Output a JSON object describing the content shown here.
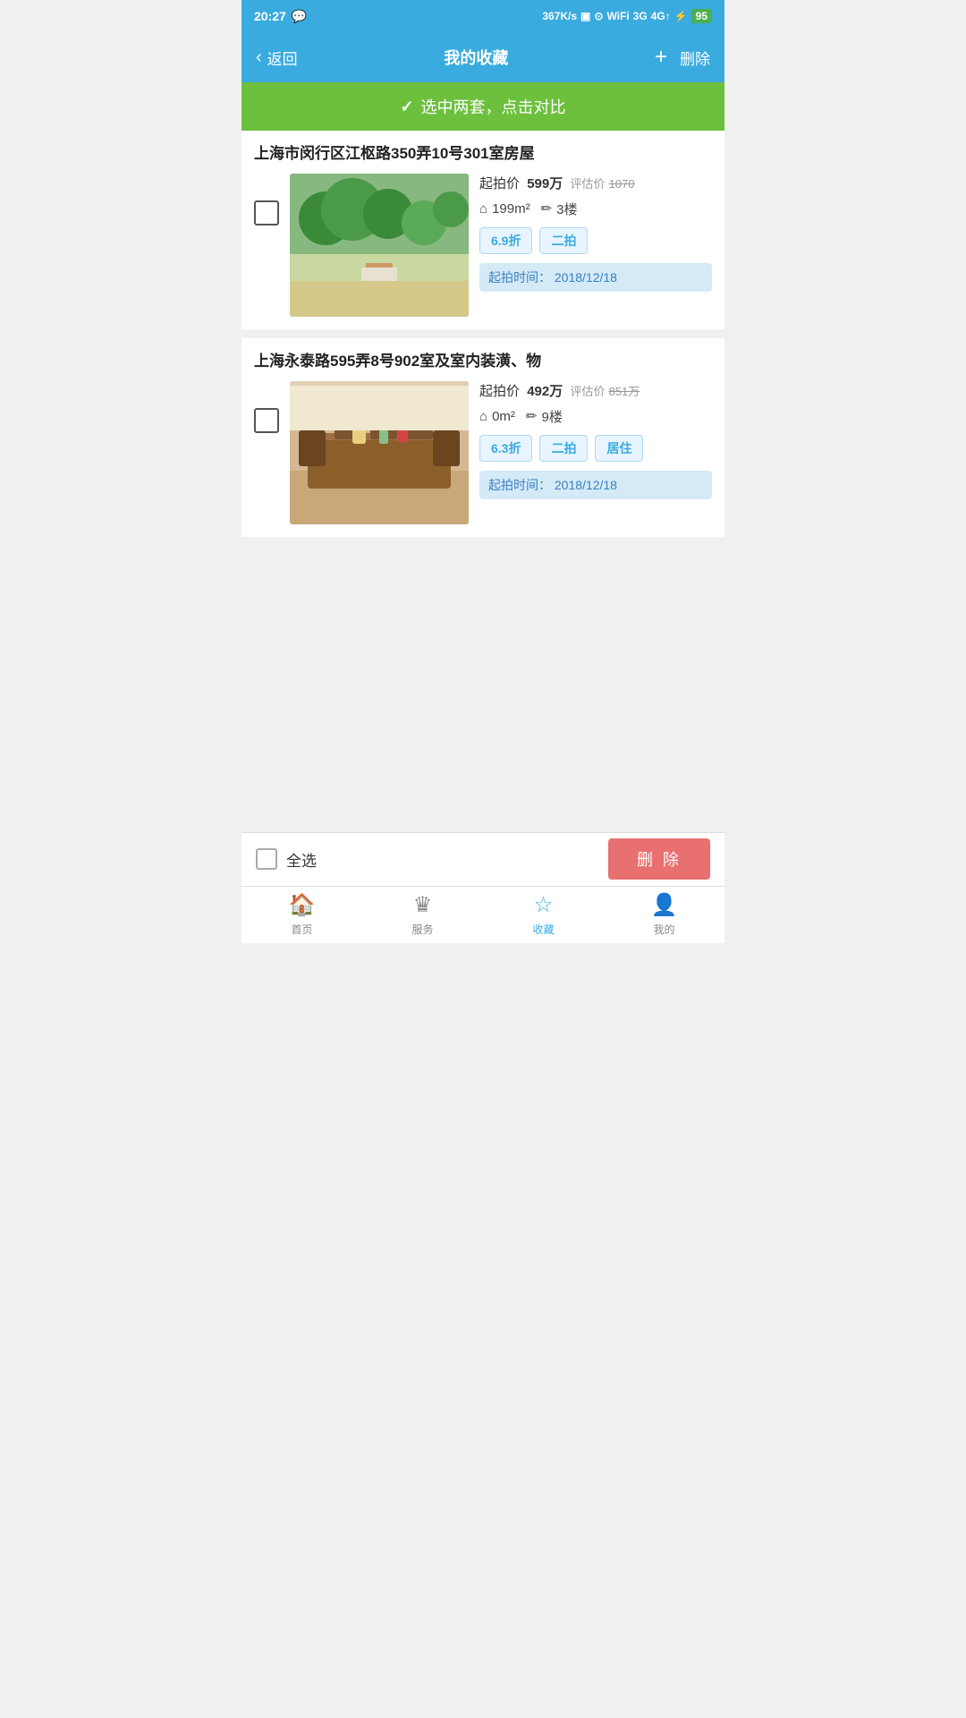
{
  "statusBar": {
    "time": "20:27",
    "network": "367K/s",
    "battery": "95"
  },
  "header": {
    "backLabel": "返回",
    "title": "我的收藏",
    "addLabel": "+",
    "deleteLabel": "删除"
  },
  "compareBanner": {
    "icon": "✓",
    "label": "选中两套，点击对比"
  },
  "properties": [
    {
      "id": "prop1",
      "title": "上海市闵行区江枢路350弄10号301室房屋",
      "startPriceLabel": "起拍价",
      "startPrice": "599万",
      "estimateLabel": "评估价",
      "estimatePrice": "1070",
      "area": "199m²",
      "floor": "3楼",
      "tags": [
        "6.9折",
        "二拍"
      ],
      "auctionTimeLabel": "起拍时间：",
      "auctionTime": "2018/12/18",
      "imageAlt": "property-1"
    },
    {
      "id": "prop2",
      "title": "上海永泰路595弄8号902室及室内装潢、物",
      "startPriceLabel": "起拍价",
      "startPrice": "492万",
      "estimateLabel": "评估价",
      "estimatePrice": "851万",
      "area": "0m²",
      "floor": "9楼",
      "tags": [
        "6.3折",
        "二拍",
        "居住"
      ],
      "auctionTimeLabel": "起拍时间：",
      "auctionTime": "2018/12/18",
      "imageAlt": "property-2"
    }
  ],
  "bottomBar": {
    "selectAllLabel": "全选",
    "deleteLabel": "删 除"
  },
  "tabBar": {
    "tabs": [
      {
        "id": "home",
        "label": "首页",
        "icon": "home"
      },
      {
        "id": "service",
        "label": "服务",
        "icon": "crown"
      },
      {
        "id": "favorites",
        "label": "收藏",
        "icon": "star",
        "active": true
      },
      {
        "id": "mine",
        "label": "我的",
        "icon": "person"
      }
    ]
  }
}
